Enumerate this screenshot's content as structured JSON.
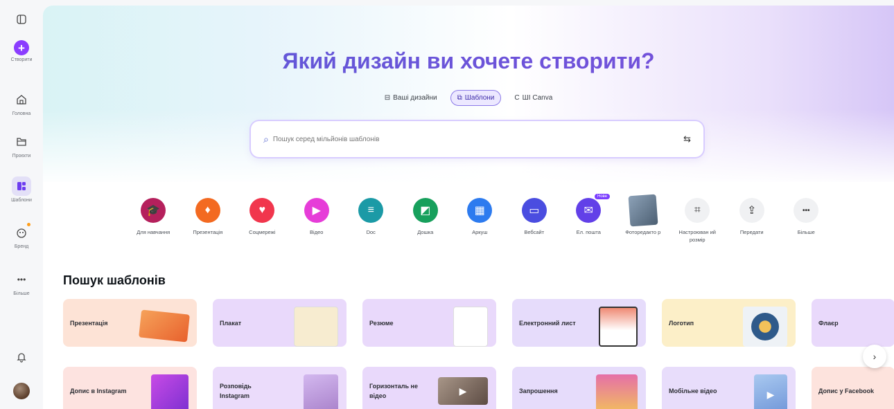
{
  "sidebar": {
    "toggle_icon": "sidebar-toggle-icon",
    "items": [
      {
        "label": "Створити",
        "icon": "plus-icon"
      },
      {
        "label": "Головна",
        "icon": "home-icon"
      },
      {
        "label": "Проєкти",
        "icon": "folder-icon"
      },
      {
        "label": "Шаблони",
        "icon": "templates-icon"
      },
      {
        "label": "Бренд",
        "icon": "brand-icon"
      },
      {
        "label": "Більше",
        "icon": "more-icon"
      }
    ]
  },
  "hero": {
    "title": "Який дизайн ви хочете створити?",
    "tabs": [
      {
        "label": "Ваші дизайни",
        "icon": "folder-icon"
      },
      {
        "label": "Шаблони",
        "icon": "templates-icon"
      },
      {
        "label": "ШІ Canva",
        "icon": "ai-icon"
      }
    ],
    "search_placeholder": "Пошук серед мільйонів шаблонів"
  },
  "categories": [
    {
      "label": "Для навчання",
      "color": "#b5205c",
      "glyph": "🎓"
    },
    {
      "label": "Презентація",
      "color": "#f36a21",
      "glyph": "♦"
    },
    {
      "label": "Соцмережі",
      "color": "#f1364d",
      "glyph": "♥"
    },
    {
      "label": "Відео",
      "color": "#e63dd8",
      "glyph": "▶"
    },
    {
      "label": "Doc",
      "color": "#1b9aa6",
      "glyph": "≡"
    },
    {
      "label": "Дошка",
      "color": "#17a05c",
      "glyph": "◩"
    },
    {
      "label": "Аркуш",
      "color": "#2d7bef",
      "glyph": "▦"
    },
    {
      "label": "Вебсайт",
      "color": "#4a4de0",
      "glyph": "▭"
    },
    {
      "label": "Ел. пошта",
      "color": "#6240e8",
      "glyph": "✉",
      "badge": "Нове"
    },
    {
      "label": "Фоторедакто р",
      "color": "",
      "glyph": ""
    },
    {
      "label": "Настроюван ий розмір",
      "color": "#f0f1f3",
      "glyph": "⌗"
    },
    {
      "label": "Передати",
      "color": "#f0f1f3",
      "glyph": "⇪"
    },
    {
      "label": "Більше",
      "color": "#f0f1f3",
      "glyph": "•••"
    }
  ],
  "section_title": "Пошук шаблонів",
  "templates": [
    {
      "label": "Презентація",
      "bg": "#fde3d6",
      "art": "#f08a3c"
    },
    {
      "label": "Плакат",
      "bg": "#e9d9fb",
      "art": "#f7ecd0"
    },
    {
      "label": "Резюме",
      "bg": "#e9d9fb",
      "art": "#ffffff"
    },
    {
      "label": "Електронний лист",
      "bg": "#e6dcfb",
      "art": "#ef8a74"
    },
    {
      "label": "Логотип",
      "bg": "#fcefc8",
      "art": "#e2e9f0"
    },
    {
      "label": "Флаєр",
      "bg": "#e9d9fb",
      "art": "#f2c1d6"
    },
    {
      "label": "Допис в Instagram",
      "bg": "#fde3e0",
      "art": "#b83be0"
    },
    {
      "label": "Розповідь Instagram",
      "bg": "#ebdcfb",
      "art": "#c8a9e8"
    },
    {
      "label": "Горизонталь не відео",
      "bg": "#e9d9fb",
      "art": "#7b6a5f"
    },
    {
      "label": "Запрошення",
      "bg": "#e6dcfb",
      "art": "#e56fa8"
    },
    {
      "label": "Мобільне відео",
      "bg": "#e8ddfb",
      "art": "#8fb5e8"
    },
    {
      "label": "Допис у Facebook",
      "bg": "#fde3dd",
      "art": "#f5b2a0"
    }
  ]
}
